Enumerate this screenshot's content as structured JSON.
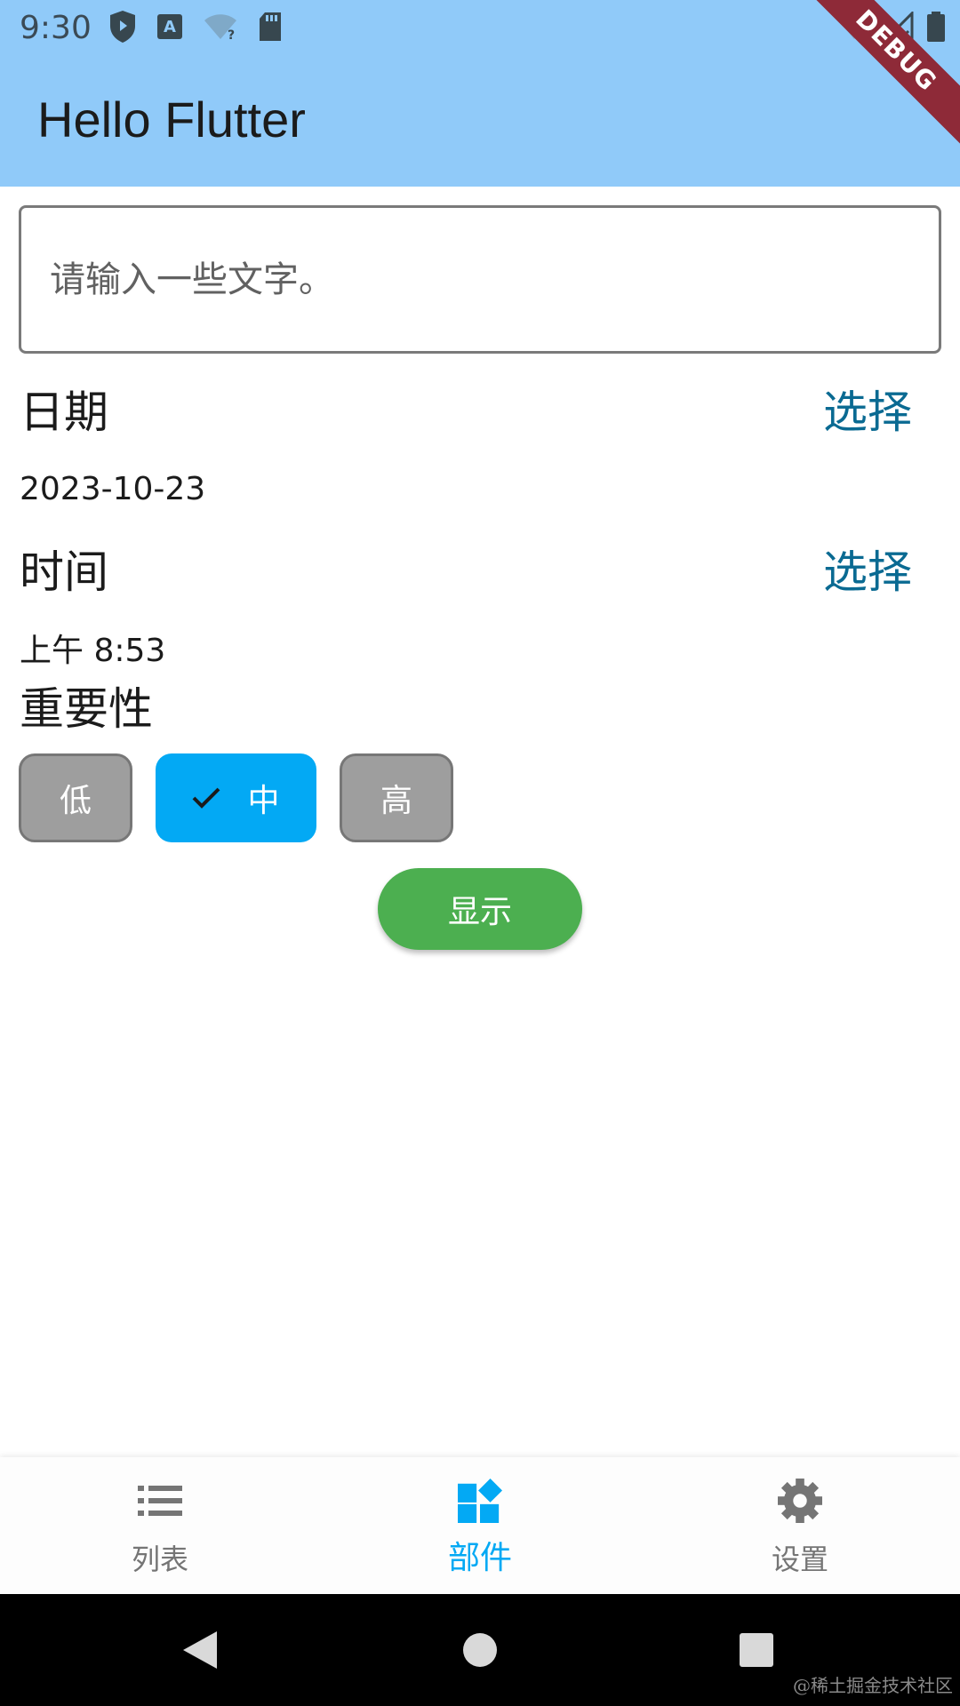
{
  "status_bar": {
    "time": "9:30",
    "left_icons": [
      "shield-icon",
      "font-download-icon",
      "wifi-question-icon",
      "sd-card-icon"
    ],
    "right_icons": [
      "wifi-off-icon",
      "signal-off-icon",
      "battery-icon"
    ]
  },
  "app_bar": {
    "title": "Hello Flutter",
    "background": "#90caf9",
    "debug_banner": "DEBUG"
  },
  "text_input": {
    "value": "",
    "placeholder": "请输入一些文字。"
  },
  "date_row": {
    "label": "日期",
    "action": "选择",
    "value": "2023-10-23"
  },
  "time_row": {
    "label": "时间",
    "action": "选择",
    "value": "上午 8:53"
  },
  "importance": {
    "label": "重要性",
    "options": [
      "低",
      "中",
      "高"
    ],
    "selected": "中",
    "selected_color": "#03a9f4",
    "unselected_color": "#9e9e9e"
  },
  "show_button": {
    "label": "显示",
    "color": "#4caf50"
  },
  "bottom_nav": {
    "items": [
      {
        "label": "列表",
        "icon": "list-icon"
      },
      {
        "label": "部件",
        "icon": "widgets-icon"
      },
      {
        "label": "设置",
        "icon": "settings-icon"
      }
    ],
    "active": "部件",
    "active_color": "#03a9f4"
  },
  "system_nav": {
    "buttons": [
      "back-icon",
      "home-icon",
      "recents-icon"
    ]
  },
  "watermark": "@稀土掘金技术社区"
}
